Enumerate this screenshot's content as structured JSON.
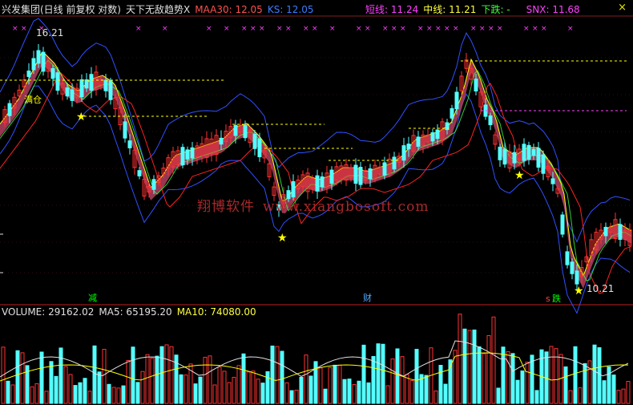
{
  "header": {
    "stock_name": "兴发集团(日线 前复权 对数)",
    "indicator": "天下无敌趋势X",
    "maa30": "MAA30: 12.05",
    "ks": "KS: 12.05",
    "short_line": "短线: 11.24",
    "mid_line": "中线: 11.21",
    "down": "下跌: -",
    "snx": "SNX: 11.68",
    "close_glyph": "×"
  },
  "price_panel": {
    "high_label": "16.21",
    "low_label": "10.21",
    "annotation_buy": "满仓",
    "signals": [
      {
        "text": "减",
        "color": "#00ff00"
      },
      {
        "text": "财",
        "color": "#55aaff"
      },
      {
        "text": "s",
        "color": "#ff4040"
      },
      {
        "text": "跌",
        "color": "#00ff00"
      }
    ],
    "watermark_cn": "翔博软件",
    "watermark_url": "www.xiangbosoft.com"
  },
  "volume_panel": {
    "volume": "VOLUME: 29162.02",
    "ma5": "MA5: 65195.20",
    "ma10": "MA10: 74080.00"
  },
  "colors": {
    "up": "#ff3232",
    "down": "#54ffff",
    "ma_band": "#b04060",
    "yellow": "#ffff00",
    "blue": "#3050ff",
    "magenta": "#ff40ff"
  }
}
